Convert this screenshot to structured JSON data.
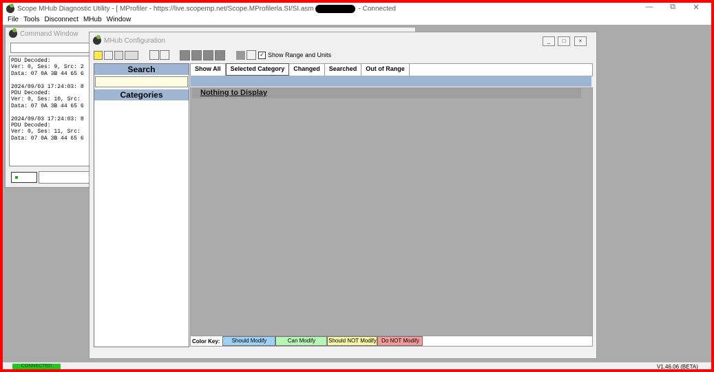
{
  "app": {
    "title_prefix": "Scope MHub Diagnostic Utility - [ MProfiler - https://live.scopemp.net/Scope.MProfilerla.SI/SI.asm",
    "title_suffix": " - Connected",
    "win_min": "—",
    "win_restore": "⧉",
    "win_close": "✕"
  },
  "menu": [
    "File",
    "Tools",
    "Disconnect",
    "MHub",
    "Window"
  ],
  "command_window": {
    "title": "Command Window",
    "log": "PDU Decoded:\nVer: 0, Ses: 9, Src: 2\nData: 07 0A 3B 44 65 6\n\n2024/09/03 17:24:03: 8\nPDU Decoded:\nVer: 0, Ses: 10, Src:\nData: 07 0A 3B 44 65 6\n\n2024/09/03 17:24:03: 8\nPDU Decoded:\nVer: 0, Ses: 11, Src:\nData: 07 0A 3B 44 65 6"
  },
  "mhub": {
    "title": "MHub Configuration",
    "show_range_label": "Show Range and Units",
    "search_header": "Search",
    "categories_header": "Categories",
    "tabs": [
      "Show All",
      "Selected Category",
      "Changed",
      "Searched",
      "Out of Range"
    ],
    "selected_tab": "Selected Category",
    "empty_message": "Nothing to Display",
    "color_key_label": "Color Key:",
    "color_key": [
      {
        "label": "Should Modify",
        "color": "#9fd0f5"
      },
      {
        "label": "Can Modify",
        "color": "#b8f5b8"
      },
      {
        "label": "Should NOT Modify",
        "color": "#fbf6a8"
      },
      {
        "label": "Do NOT Modify",
        "color": "#f59a9a"
      }
    ]
  },
  "status": {
    "connected": "CONNECTED",
    "version": "V1.46.06 (BETA)"
  },
  "colors": {
    "frame": "#ff0000",
    "panel_header": "#9eb6d3",
    "mdi_background": "#ababab"
  }
}
